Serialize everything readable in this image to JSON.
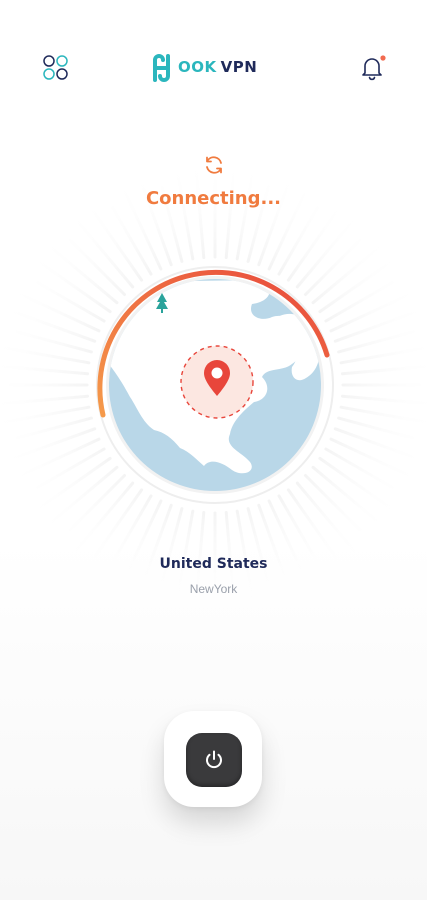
{
  "header": {
    "logo_hook": "OOK",
    "logo_vpn": "VPN",
    "menu_icon": "grid-circles-icon",
    "notification_icon": "bell-icon",
    "notification_badge_color": "#f26a4f"
  },
  "status": {
    "label": "Connecting...",
    "icon": "refresh-icon",
    "color": "#f07b3f",
    "progress": 0.5
  },
  "location": {
    "country": "United States",
    "city": "NewYork"
  },
  "power": {
    "icon": "power-icon"
  },
  "colors": {
    "brand_teal": "#2bb6bd",
    "brand_navy": "#1f2a5a",
    "accent_orange": "#f07b3f",
    "accent_red": "#e8463b",
    "map_water": "#b9d7e8"
  }
}
